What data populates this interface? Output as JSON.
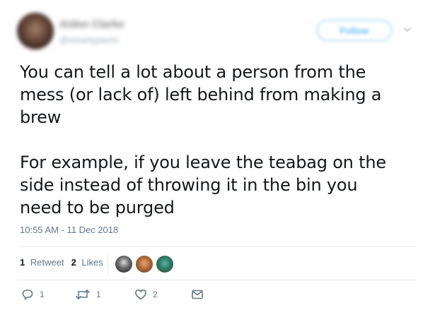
{
  "author": {
    "display_name": "Aiden Clarke",
    "handle": "@smartypants"
  },
  "follow_label": "Follow",
  "tweet": {
    "text": "You can tell a lot about a person from the\nmess (or lack of) left behind from making a\nbrew\n\nFor example, if you leave the teabag on the\nside instead of throwing it in the bin you\nneed to be purged",
    "timestamp": "10:55 AM - 11 Dec 2018"
  },
  "stats": {
    "retweets_count": "1",
    "retweets_label": "Retweet",
    "likes_count": "2",
    "likes_label": "Likes"
  },
  "actions": {
    "reply_count": "1",
    "retweet_count": "1",
    "like_count": "2"
  },
  "icons": {
    "reply": "reply-icon",
    "retweet": "retweet-icon",
    "like": "heart-icon",
    "dm": "envelope-icon",
    "menu": "chevron-down-icon"
  },
  "colors": {
    "text": "#14171a",
    "muted": "#657786",
    "accent": "#1da1f2",
    "divider": "#e6ecf0"
  }
}
